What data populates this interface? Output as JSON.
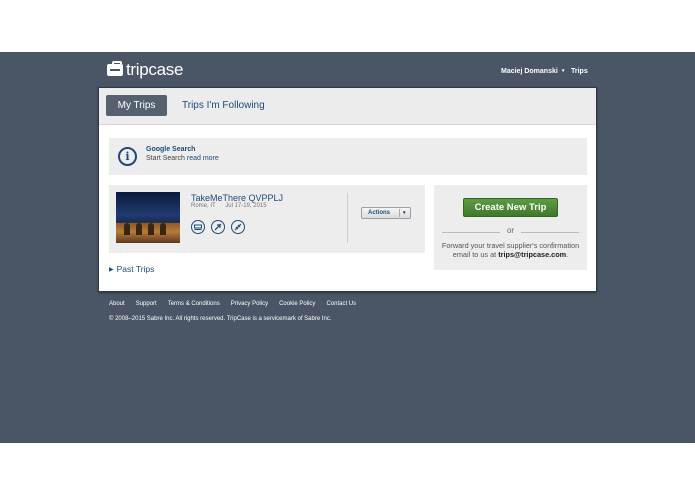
{
  "brand": {
    "name": "tripcase",
    "logo_icon": "suitcase-icon"
  },
  "topnav": {
    "user_name": "Maciej Domanski",
    "user_caret": "▾",
    "trips_link": "Trips"
  },
  "tabs": {
    "active": "My Trips",
    "second": "Trips I'm Following"
  },
  "notice": {
    "icon": "info-icon",
    "title": "Google Search",
    "subtitle_prefix": "Start Search",
    "link": "read more"
  },
  "trip": {
    "name": "TakeMeThere QVPPLJ",
    "location": "Rome, IT",
    "dates": "Jul 17-19, 2015",
    "segment_icons": [
      "hotel-icon",
      "flight-icon",
      "rail-icon"
    ],
    "actions_label": "Actions",
    "actions_caret": "▾"
  },
  "create": {
    "button_label": "Create New Trip",
    "or": "or",
    "forward_text": "Forward your travel supplier's confirmation email to us at",
    "email": "trips@tripcase.com",
    "period": "."
  },
  "past_trips": {
    "arrow": "▶",
    "label": "Past Trips"
  },
  "footer": {
    "links": [
      "About",
      "Support",
      "Terms & Conditions",
      "Privacy Policy",
      "Cookie Policy",
      "Contact Us"
    ],
    "copyright": "© 2008–2015 Sabre Inc. All rights reserved. TripCase is a servicemark of Sabre Inc."
  },
  "colors": {
    "band": "#4a5566",
    "link": "#1e4a7a",
    "create_button": "#4c8a35",
    "tab_active": "#56616f"
  }
}
